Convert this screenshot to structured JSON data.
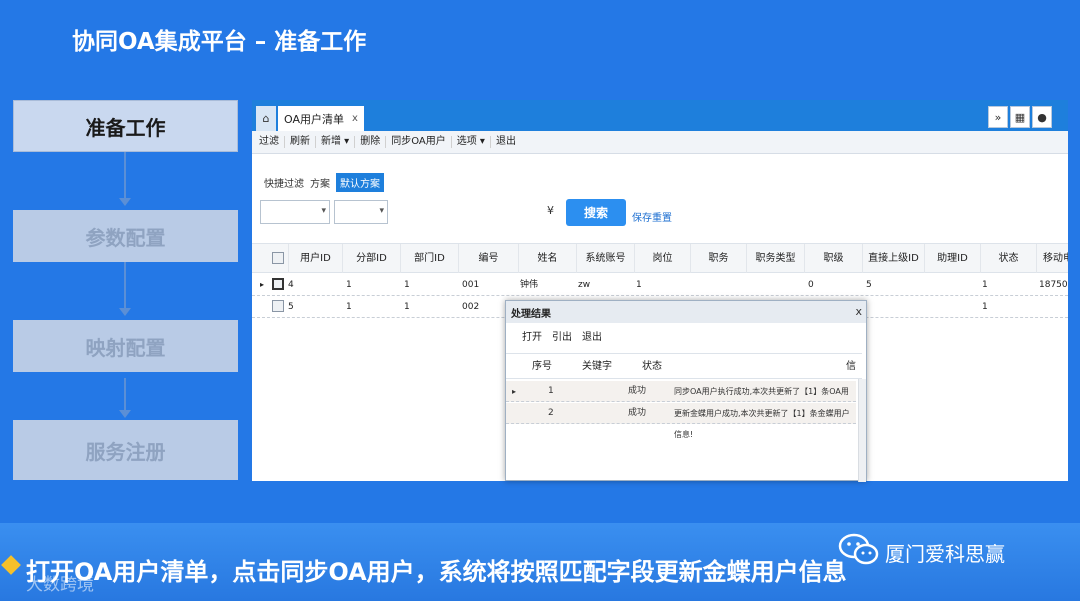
{
  "slide": {
    "title": "协同OA集成平台 – 准备工作"
  },
  "steps": [
    {
      "label": "准备工作",
      "active": true
    },
    {
      "label": "参数配置",
      "active": false
    },
    {
      "label": "映射配置",
      "active": false
    },
    {
      "label": "服务注册",
      "active": false
    }
  ],
  "app": {
    "home_icon": "home-icon",
    "tab": {
      "label": "OA用户清单",
      "close": "x"
    },
    "toolbar": [
      "过滤",
      "刷新",
      "新增 ▾",
      "删除",
      "同步OA用户",
      "选项 ▾",
      "退出"
    ],
    "filter": {
      "quick": "快捷过滤",
      "scheme": "方案",
      "default_scheme": "默认方案"
    },
    "search_button": "搜索",
    "save_link": "保存",
    "reset_link": "重置",
    "columns": [
      "用户ID",
      "分部ID",
      "部门ID",
      "编号",
      "姓名",
      "系统账号",
      "岗位",
      "职务",
      "职务类型",
      "职级",
      "直接上级ID",
      "助理ID",
      "状态",
      "移动电话"
    ],
    "rows": [
      {
        "用户ID": "4",
        "分部ID": "1",
        "部门ID": "1",
        "编号": "001",
        "姓名": "钟伟",
        "系统账号": "zw",
        "岗位": "1",
        "职级": "0",
        "直接上级ID": "5",
        "状态": "1",
        "移动电话": "18750("
      },
      {
        "用户ID": "5",
        "分部ID": "1",
        "部门ID": "1",
        "编号": "002",
        "状态": "1"
      }
    ]
  },
  "dialog": {
    "title": "处理结果",
    "close": "x",
    "toolbar": [
      "打开",
      "引出",
      "退出"
    ],
    "columns": [
      "序号",
      "关键字",
      "状态",
      "信息"
    ],
    "rows": [
      {
        "seq": "1",
        "status": "成功",
        "info": "同步OA用户执行成功,本次共更新了【1】条OA用户信息!"
      },
      {
        "seq": "2",
        "status": "成功",
        "info": "更新金蝶用户成功,本次共更新了【1】条金蝶用户信息!"
      }
    ]
  },
  "footer": {
    "text": "打开OA用户清单，点击同步OA用户，系统将按照匹配字段更新金蝶用户信息",
    "watermark_left": "大数跨境",
    "watermark_right": "厦门爱科思赢"
  },
  "colors": {
    "background": "#2478e6",
    "accent": "#1e7fdc",
    "banner": "#3a8ff0"
  }
}
